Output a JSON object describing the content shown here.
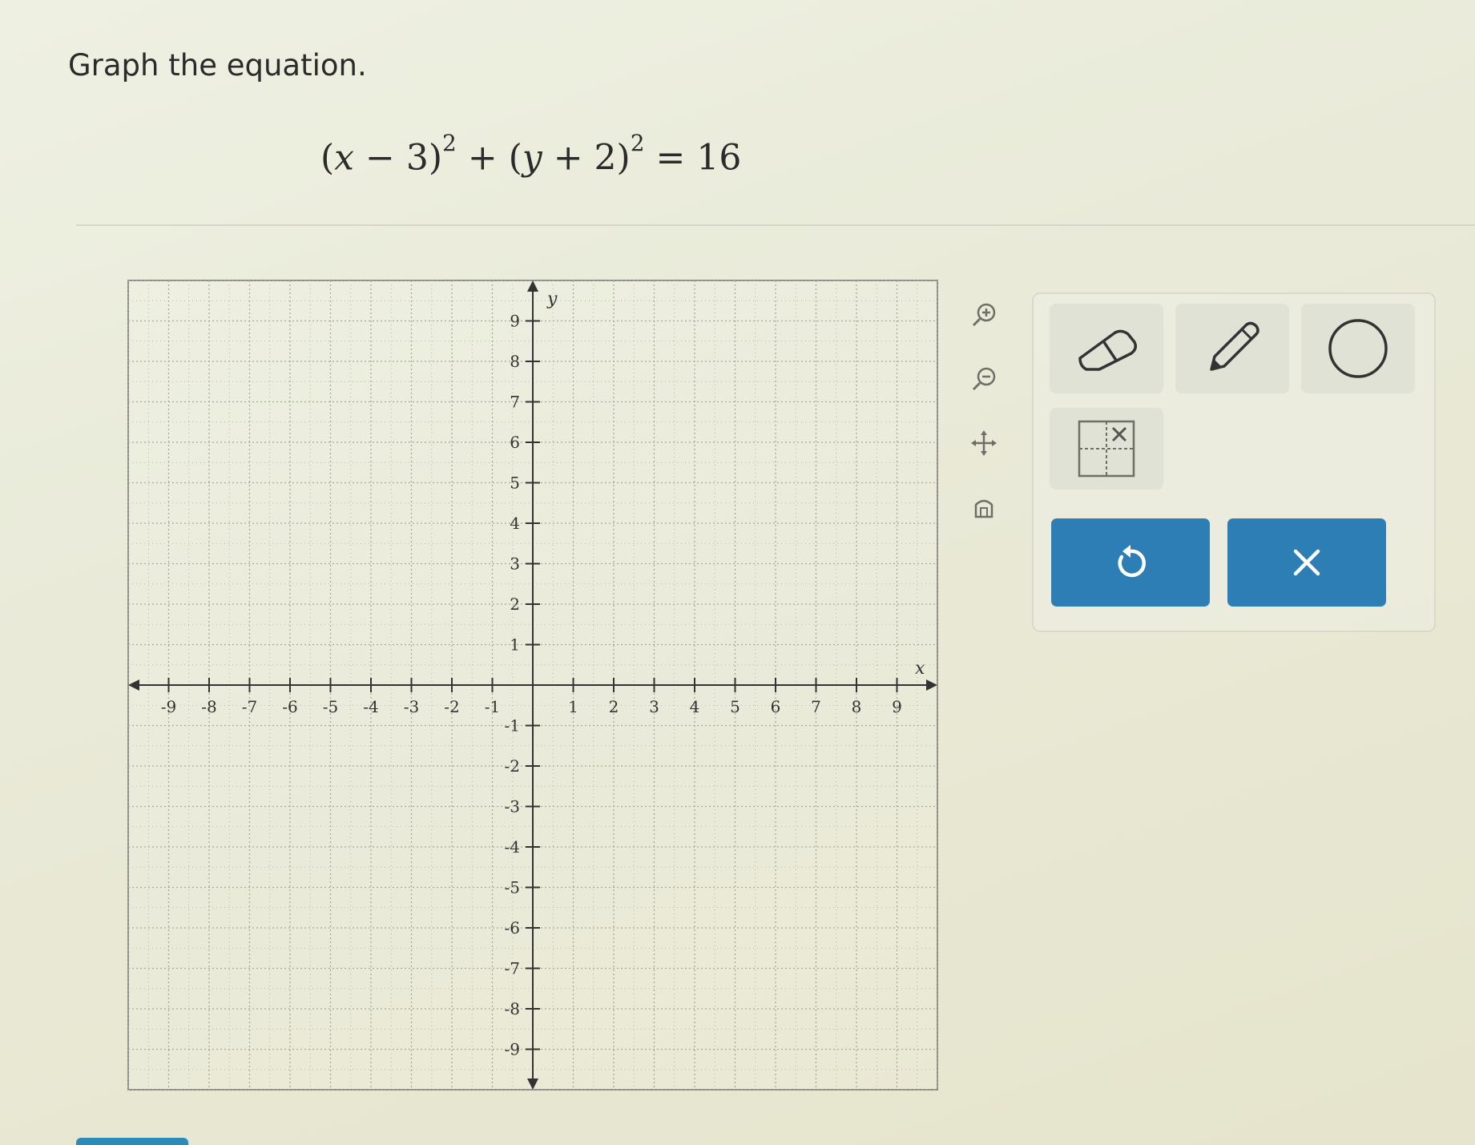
{
  "prompt": {
    "instruction": "Graph the equation.",
    "equation": {
      "paren1_open": "(",
      "var_x": "x",
      "op1": " − 3)",
      "exp1": "2",
      "plus": " + (",
      "var_y": "y",
      "op2": " + 2)",
      "exp2": "2",
      "equals": " = 16"
    }
  },
  "graph": {
    "x_axis_label": "x",
    "y_axis_label": "y",
    "x_range": [
      -9,
      9
    ],
    "y_range": [
      -9,
      9
    ],
    "x_ticks": [
      "-9",
      "-8",
      "-7",
      "-6",
      "-5",
      "-4",
      "-3",
      "-2",
      "-1",
      "1",
      "2",
      "3",
      "4",
      "5",
      "6",
      "7",
      "8",
      "9"
    ],
    "y_ticks": [
      "9",
      "8",
      "7",
      "6",
      "5",
      "4",
      "3",
      "2",
      "1",
      "-1",
      "-2",
      "-3",
      "-4",
      "-5",
      "-6",
      "-7",
      "-8",
      "-9"
    ],
    "minor_grid": true,
    "colors": {
      "grid": "#a9a9a0",
      "axis": "#333333",
      "border": "#8e8e86"
    }
  },
  "side_tools": [
    {
      "icon": "zoom-in-icon"
    },
    {
      "icon": "zoom-out-icon"
    },
    {
      "icon": "pan-icon"
    },
    {
      "icon": "home-icon"
    }
  ],
  "tools": [
    {
      "icon": "eraser-icon"
    },
    {
      "icon": "pencil-icon"
    },
    {
      "icon": "circle-tool-icon"
    },
    {
      "icon": "no-solution-icon"
    }
  ],
  "actions": [
    {
      "icon": "undo-icon"
    },
    {
      "icon": "clear-icon"
    }
  ],
  "colors": {
    "action_button": "#2c7eb4",
    "accent": "#2c8cb9"
  }
}
